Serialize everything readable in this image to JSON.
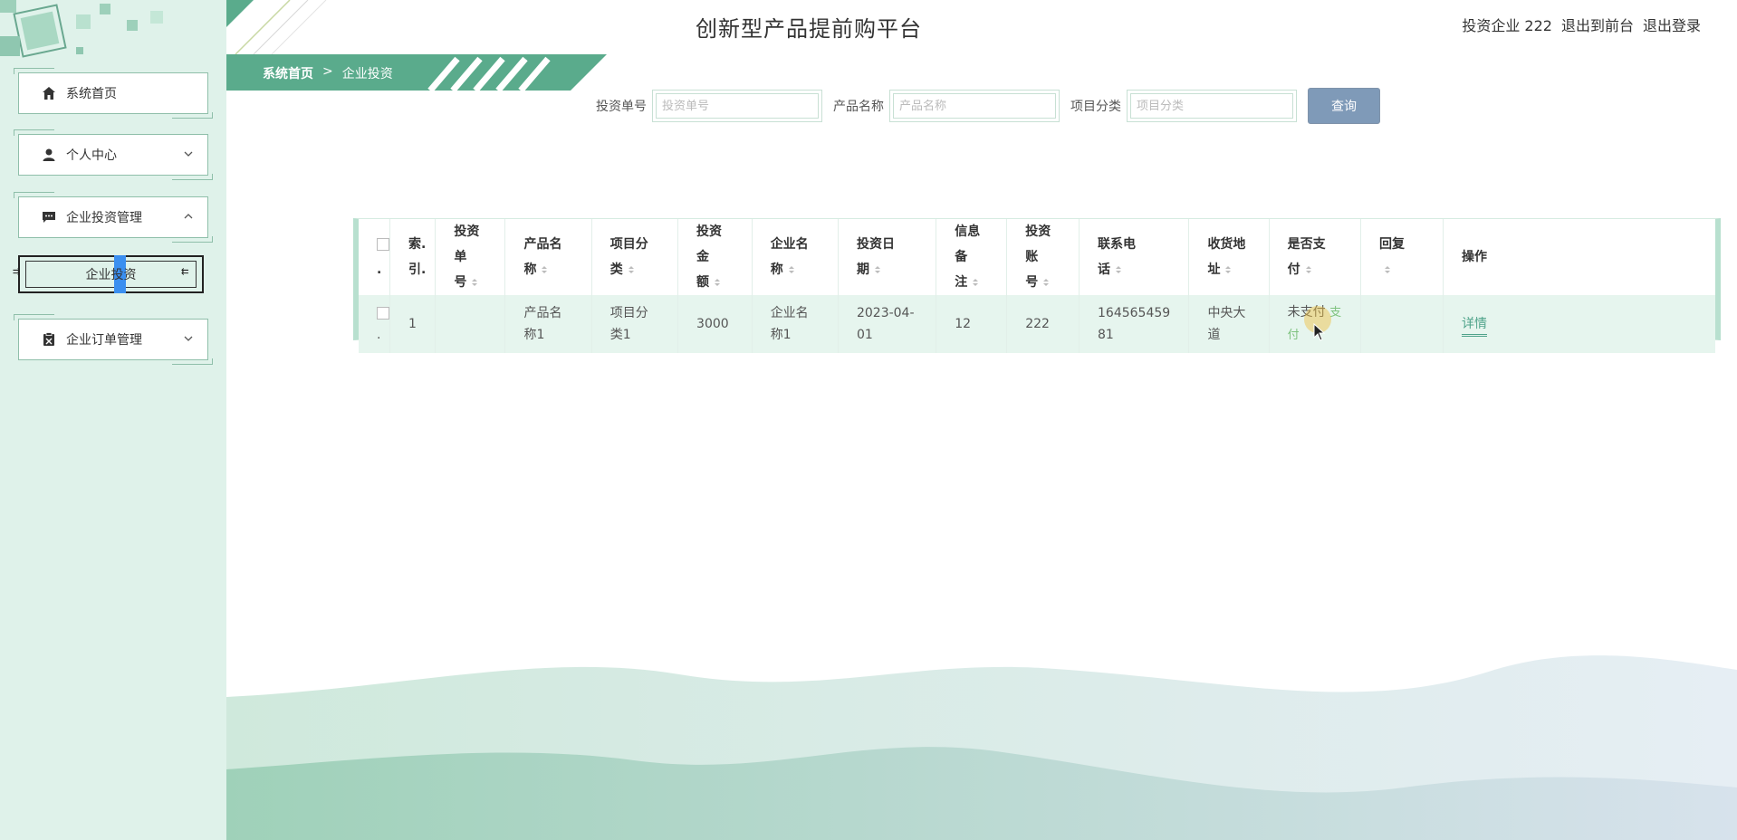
{
  "header": {
    "title": "创新型产品提前购平台",
    "user": "投资企业 222",
    "to_front": "退出到前台",
    "logout": "退出登录"
  },
  "breadcrumb": {
    "home": "系统首页",
    "separator": ">",
    "current": "企业投资"
  },
  "sidebar": {
    "items": [
      {
        "label": "系统首页",
        "icon": "home-icon"
      },
      {
        "label": "个人中心",
        "icon": "user-icon",
        "arrow": "chevron-down-icon"
      },
      {
        "label": "企业投资管理",
        "icon": "message-icon",
        "arrow": "chevron-up-icon"
      },
      {
        "label": "企业订单管理",
        "icon": "clipboard-icon",
        "arrow": "chevron-down-icon"
      }
    ],
    "sub_item": "企业投资"
  },
  "search": {
    "fields": [
      {
        "label": "投资单号",
        "placeholder": "投资单号"
      },
      {
        "label": "产品名称",
        "placeholder": "产品名称"
      },
      {
        "label": "项目分类",
        "placeholder": "项目分类"
      }
    ],
    "button": "查询"
  },
  "table": {
    "headers": [
      "索.\n引.",
      "投资单\n号",
      "产品名\n称",
      "项目分\n类",
      "投资金\n额",
      "企业名\n称",
      "投资日\n期",
      "信息备\n注",
      "投资账\n号",
      "联系电\n话",
      "收货地\n址",
      "是否支\n付",
      "回复",
      "操作"
    ],
    "rows": [
      {
        "index": "1",
        "order_no": "",
        "product": "产品名称1",
        "category": "项目分类1",
        "amount": "3000",
        "company": "企业名称1",
        "date": "2023-04-01",
        "note": "12",
        "account": "222",
        "phone": "16456545981",
        "address": "中央大道",
        "paid": "未支付",
        "pay_action": "支付",
        "reply": "",
        "detail": "详情"
      }
    ]
  },
  "colors": {
    "sidebar_bg": "#dff2ea",
    "accent_green": "#5aab8c",
    "button_blue": "#7f9ab8",
    "row_bg": "#e6f5ee"
  }
}
